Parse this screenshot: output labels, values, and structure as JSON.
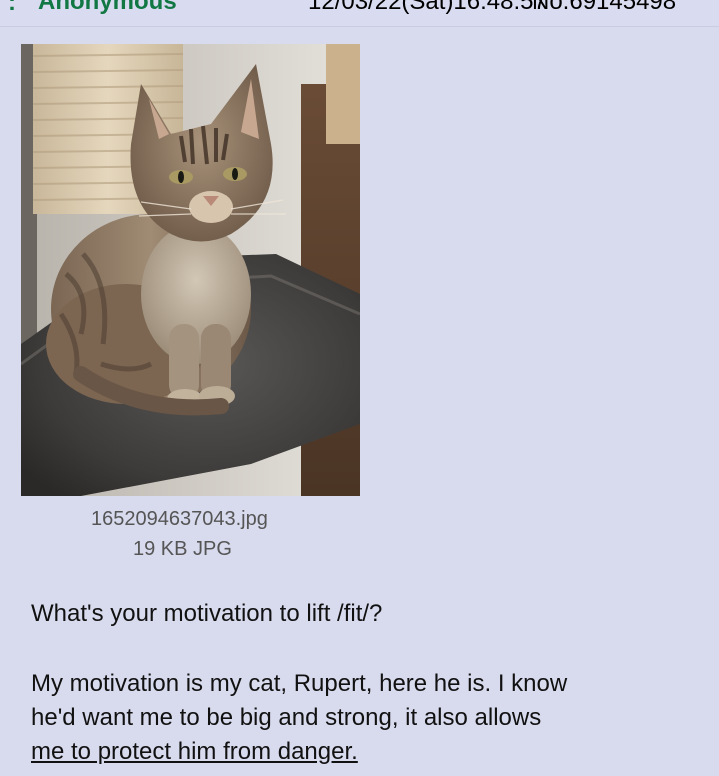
{
  "post": {
    "header": {
      "colon": ":",
      "name": "Anonymous",
      "datetime": "12/03/22(Sat)16:48:57",
      "number": "No.69145498"
    },
    "file": {
      "name": "1652094637043.jpg",
      "meta": "19 KB JPG"
    },
    "message": {
      "question": "What's your motivation to lift /fit/?",
      "answer_line1": "My motivation is my cat, Rupert, here he is. I know",
      "answer_line2": "he'd want me to be big and strong, it also allows",
      "answer_line3": "me to protect him from danger."
    }
  }
}
